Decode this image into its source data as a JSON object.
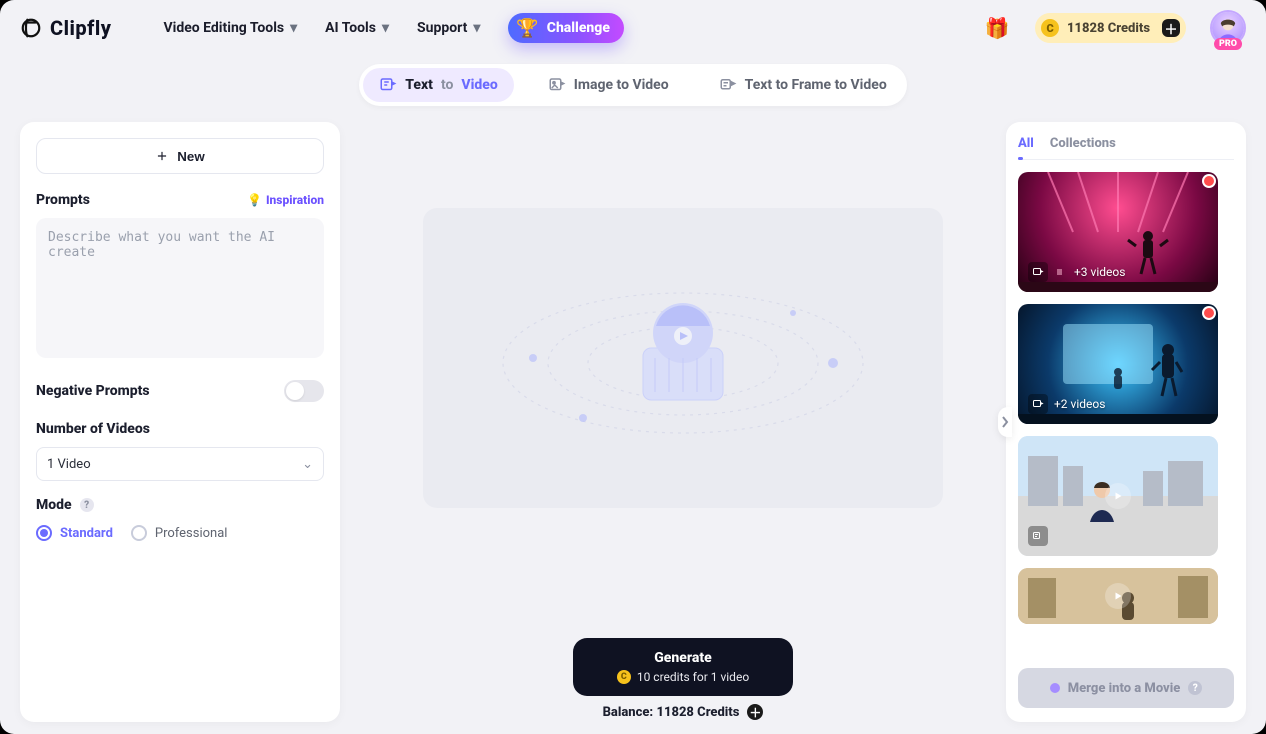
{
  "header": {
    "brand": "Clipfly",
    "nav": {
      "video_editing": "Video Editing Tools",
      "ai_tools": "AI Tools",
      "support": "Support",
      "challenge": "Challenge"
    },
    "credits_label": "11828 Credits",
    "pro_badge": "PRO"
  },
  "tabs": {
    "t1_a": "Text",
    "t1_b": "to",
    "t1_c": "Video",
    "t2": "Image to Video",
    "t3": "Text to Frame to Video"
  },
  "left": {
    "new_label": "New",
    "prompts_title": "Prompts",
    "inspiration_label": "Inspiration",
    "prompt_placeholder": "Describe what you want the AI create",
    "negative_title": "Negative Prompts",
    "numvideos_title": "Number of Videos",
    "numvideos_value": "1 Video",
    "mode_title": "Mode",
    "mode_standard": "Standard",
    "mode_pro": "Professional"
  },
  "center": {
    "generate_title": "Generate",
    "generate_sub": "10 credits for 1 video",
    "balance": "Balance: 11828 Credits"
  },
  "right": {
    "tab_all": "All",
    "tab_collections": "Collections",
    "thumbs": {
      "t1_label": "+3 videos",
      "t2_label": "+2 videos"
    },
    "merge_label": "Merge into a Movie"
  }
}
